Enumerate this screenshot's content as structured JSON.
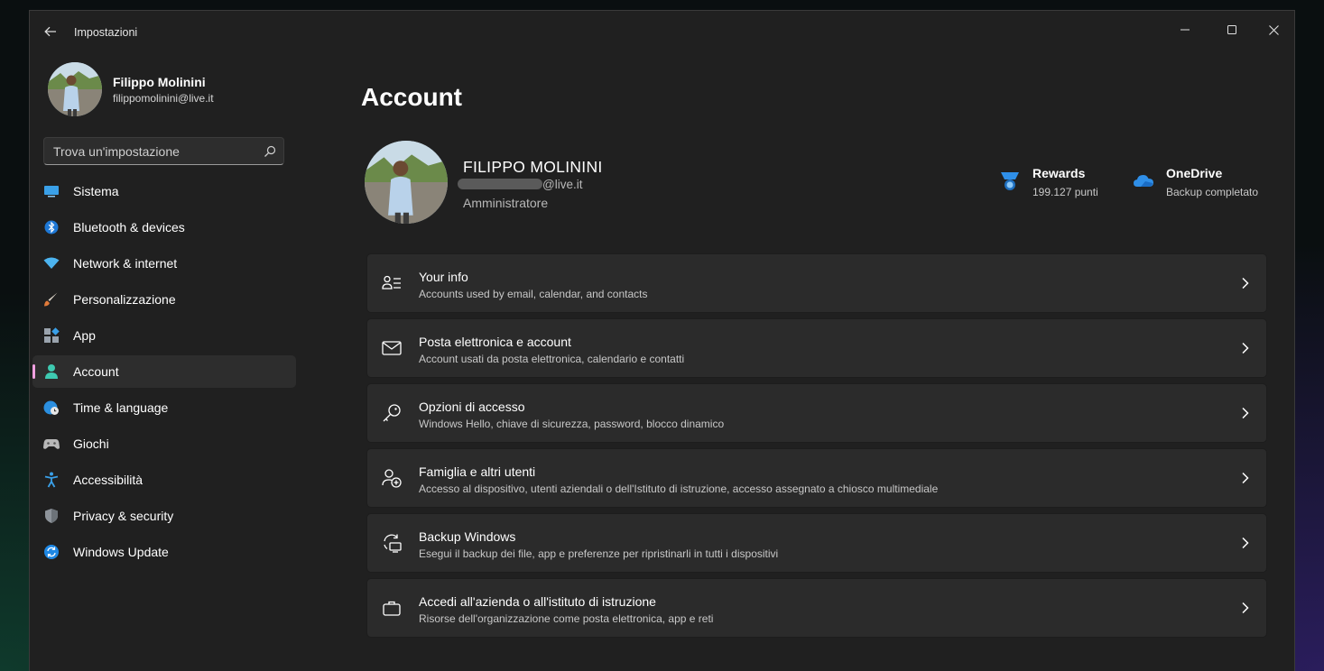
{
  "window": {
    "title": "Impostazioni"
  },
  "profile": {
    "name": "Filippo Molinini",
    "email": "filippomolinini@live.it"
  },
  "search": {
    "placeholder": "Trova un'impostazione"
  },
  "sidebar": {
    "items": [
      {
        "label": "Sistema",
        "icon": "monitor-icon"
      },
      {
        "label": "Bluetooth & devices",
        "icon": "bluetooth-icon"
      },
      {
        "label": "Network & internet",
        "icon": "wifi-icon"
      },
      {
        "label": "Personalizzazione",
        "icon": "brush-icon"
      },
      {
        "label": "App",
        "icon": "apps-icon"
      },
      {
        "label": "Account",
        "icon": "person-icon",
        "active": true
      },
      {
        "label": "Time & language",
        "icon": "globe-clock-icon"
      },
      {
        "label": "Giochi",
        "icon": "gamepad-icon"
      },
      {
        "label": "Accessibilità",
        "icon": "accessibility-icon"
      },
      {
        "label": "Privacy & security",
        "icon": "shield-icon"
      },
      {
        "label": "Windows Update",
        "icon": "update-icon"
      }
    ]
  },
  "main": {
    "title": "Account",
    "account": {
      "name": "FILIPPO MOLININI",
      "email_suffix": "@live.it",
      "role": "Amministratore"
    },
    "services": [
      {
        "title": "Rewards",
        "subtitle": "199.127 punti",
        "icon": "rewards-medal-icon"
      },
      {
        "title": "OneDrive",
        "subtitle": "Backup completato",
        "icon": "onedrive-cloud-icon"
      }
    ],
    "cards": [
      {
        "title": "Your info",
        "subtitle": "Accounts used by email, calendar, and contacts",
        "icon": "person-info-icon"
      },
      {
        "title": "Posta elettronica e account",
        "subtitle": "Account usati da posta elettronica, calendario e contatti",
        "icon": "mail-icon"
      },
      {
        "title": "Opzioni di accesso",
        "subtitle": "Windows Hello, chiave di sicurezza, password, blocco dinamico",
        "icon": "key-icon"
      },
      {
        "title": "Famiglia e altri utenti",
        "subtitle": "Accesso al dispositivo, utenti aziendali o dell'Istituto di istruzione, accesso assegnato a chiosco multimediale",
        "icon": "person-add-icon"
      },
      {
        "title": "Backup Windows",
        "subtitle": "Esegui il backup dei file, app e preferenze per ripristinarli in tutti i dispositivi",
        "icon": "backup-icon"
      },
      {
        "title": "Accedi all'azienda o all'istituto di istruzione",
        "subtitle": "Risorse dell'organizzazione come posta elettronica, app e reti",
        "icon": "briefcase-icon"
      }
    ]
  },
  "colors": {
    "accent": "#4cc2ff",
    "active_indicator": "#f0a0e0",
    "window_bg": "#202020",
    "card_bg": "#2b2b2b"
  }
}
